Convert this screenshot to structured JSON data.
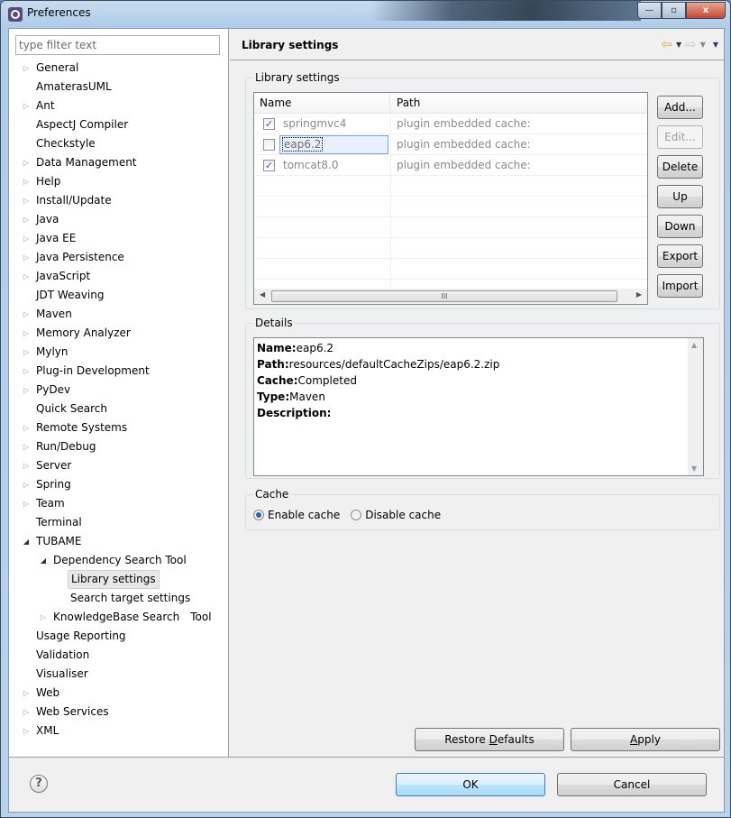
{
  "window": {
    "title": "Preferences",
    "controls": {
      "minimize": "—",
      "maximize": "▫",
      "close": "x"
    }
  },
  "sidebar": {
    "filter_placeholder": "type filter text",
    "filter_value": "",
    "items": [
      {
        "label": "General",
        "expander": "collapsed",
        "level": 0
      },
      {
        "label": "AmaterasUML",
        "expander": "none",
        "level": 0
      },
      {
        "label": "Ant",
        "expander": "collapsed",
        "level": 0
      },
      {
        "label": "AspectJ Compiler",
        "expander": "none",
        "level": 0
      },
      {
        "label": "Checkstyle",
        "expander": "none",
        "level": 0
      },
      {
        "label": "Data Management",
        "expander": "collapsed",
        "level": 0
      },
      {
        "label": "Help",
        "expander": "collapsed",
        "level": 0
      },
      {
        "label": "Install/Update",
        "expander": "collapsed",
        "level": 0
      },
      {
        "label": "Java",
        "expander": "collapsed",
        "level": 0
      },
      {
        "label": "Java EE",
        "expander": "collapsed",
        "level": 0
      },
      {
        "label": "Java Persistence",
        "expander": "collapsed",
        "level": 0
      },
      {
        "label": "JavaScript",
        "expander": "collapsed",
        "level": 0
      },
      {
        "label": "JDT Weaving",
        "expander": "none",
        "level": 0
      },
      {
        "label": "Maven",
        "expander": "collapsed",
        "level": 0
      },
      {
        "label": "Memory Analyzer",
        "expander": "collapsed",
        "level": 0
      },
      {
        "label": "Mylyn",
        "expander": "collapsed",
        "level": 0
      },
      {
        "label": "Plug-in Development",
        "expander": "collapsed",
        "level": 0
      },
      {
        "label": "PyDev",
        "expander": "collapsed",
        "level": 0
      },
      {
        "label": "Quick Search",
        "expander": "none",
        "level": 0
      },
      {
        "label": "Remote Systems",
        "expander": "collapsed",
        "level": 0
      },
      {
        "label": "Run/Debug",
        "expander": "collapsed",
        "level": 0
      },
      {
        "label": "Server",
        "expander": "collapsed",
        "level": 0
      },
      {
        "label": "Spring",
        "expander": "collapsed",
        "level": 0
      },
      {
        "label": "Team",
        "expander": "collapsed",
        "level": 0
      },
      {
        "label": "Terminal",
        "expander": "none",
        "level": 0
      },
      {
        "label": "TUBAME",
        "expander": "expanded",
        "level": 0
      },
      {
        "label": "Dependency Search Tool",
        "expander": "expanded",
        "level": 1
      },
      {
        "label": "Library settings",
        "expander": "none",
        "level": 2,
        "selected": true
      },
      {
        "label": "Search target settings",
        "expander": "none",
        "level": 2
      },
      {
        "label": "KnowledgeBase Search　Tool",
        "expander": "collapsed",
        "level": 1
      },
      {
        "label": "Usage Reporting",
        "expander": "none",
        "level": 0
      },
      {
        "label": "Validation",
        "expander": "none",
        "level": 0
      },
      {
        "label": "Visualiser",
        "expander": "none",
        "level": 0
      },
      {
        "label": "Web",
        "expander": "collapsed",
        "level": 0
      },
      {
        "label": "Web Services",
        "expander": "collapsed",
        "level": 0
      },
      {
        "label": "XML",
        "expander": "collapsed",
        "level": 0
      }
    ]
  },
  "page": {
    "title": "Library settings",
    "nav": {
      "back_icon": "⇦",
      "forward_icon": "⇨",
      "dropdown_icon": "▼"
    }
  },
  "library_group": {
    "legend": "Library settings",
    "columns": [
      "Name",
      "Path"
    ],
    "rows": [
      {
        "checked": true,
        "name": "springmvc4",
        "path": "plugin embedded cache:"
      },
      {
        "checked": false,
        "name": "eap6.2",
        "path": "plugin embedded cache:",
        "editing": true
      },
      {
        "checked": true,
        "name": "tomcat8.0",
        "path": "plugin embedded cache:"
      }
    ],
    "scroll_thumb_glyph": "III",
    "buttons": {
      "add": "Add...",
      "edit": "Edit...",
      "delete": "Delete",
      "up": "Up",
      "down": "Down",
      "export": "Export",
      "import": "Import"
    }
  },
  "details_group": {
    "legend": "Details",
    "fields": [
      {
        "key": "Name:",
        "value": "eap6.2"
      },
      {
        "key": "Path:",
        "value": "resources/defaultCacheZips/eap6.2.zip"
      },
      {
        "key": "Cache:",
        "value": "Completed"
      },
      {
        "key": "Type:",
        "value": "Maven"
      },
      {
        "key": "Description:",
        "value": ""
      }
    ]
  },
  "cache_group": {
    "legend": "Cache",
    "options": [
      {
        "label": "Enable cache",
        "selected": true
      },
      {
        "label": "Disable cache",
        "selected": false
      }
    ]
  },
  "footer": {
    "restore_prefix": "Restore ",
    "restore_mnemonic": "D",
    "restore_suffix": "efaults",
    "apply_mnemonic": "A",
    "apply_suffix": "pply",
    "ok": "OK",
    "cancel": "Cancel",
    "help_glyph": "?"
  }
}
